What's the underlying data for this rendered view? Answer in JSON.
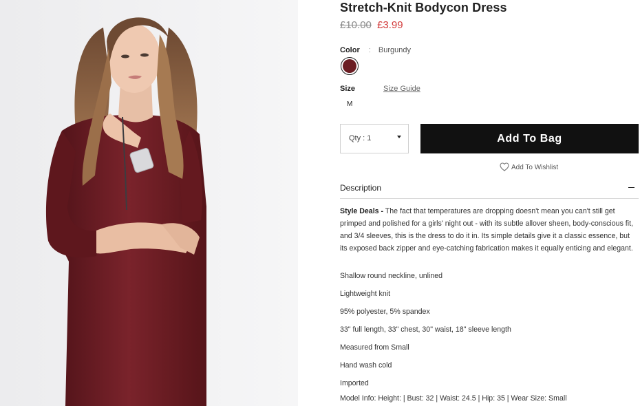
{
  "product": {
    "title": "Stretch-Knit Bodycon Dress",
    "price_original": "£10.00",
    "price_sale": "£3.99",
    "image_icon": "product-photo-model-burgundy-dress"
  },
  "color": {
    "label": "Color",
    "separator": ":",
    "value": "Burgundy",
    "swatch_hex": "#6b1d23"
  },
  "size": {
    "label": "Size",
    "guide_link": "Size Guide",
    "options": [
      "M"
    ]
  },
  "purchase": {
    "quantity_label": "Qty : 1",
    "add_to_bag_label": "Add To Bag",
    "wishlist_label": "Add To Wishlist"
  },
  "description": {
    "title": "Description",
    "toggle": "–",
    "lead": "Style Deals -",
    "text": " The fact that temperatures are dropping doesn't mean you can't still get primped and polished for a girls' night out - with its subtle allover sheen, body-conscious fit, and 3/4 sleeves, this is the dress to do it in. Its simple details give it a classic essence, but its exposed back zipper and eye-catching fabrication makes it equally enticing and elegant.",
    "details": [
      "Shallow round neckline, unlined",
      "Lightweight knit",
      "95% polyester, 5% spandex",
      "33\" full length, 33\" chest, 30\" waist, 18\" sleeve length",
      "Measured from Small",
      "Hand wash cold",
      "Imported",
      "Model Info: Height: | Bust: 32 | Waist: 24.5 | Hip: 35 | Wear Size: Small"
    ]
  },
  "colors": {
    "accent_sale": "#d23a3a",
    "button_bg": "#111111",
    "dress": "#6b1d23"
  }
}
